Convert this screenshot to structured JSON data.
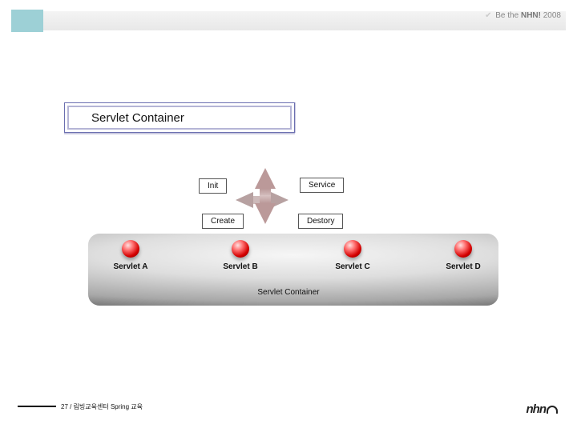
{
  "header": {
    "tagline_prefix": "Be the ",
    "tagline_brand": "NHN!",
    "year": "2008"
  },
  "title": "Servlet Container",
  "lifecycle": {
    "init": "Init",
    "service": "Service",
    "create": "Create",
    "destory": "Destory"
  },
  "servlets": {
    "a": "Servlet A",
    "b": "Servlet B",
    "c": "Servlet C",
    "d": "Servlet D"
  },
  "container_caption": "Servlet Container",
  "footer": "27 / 림빙교육센터 Spring 교육",
  "logo": "nhn"
}
